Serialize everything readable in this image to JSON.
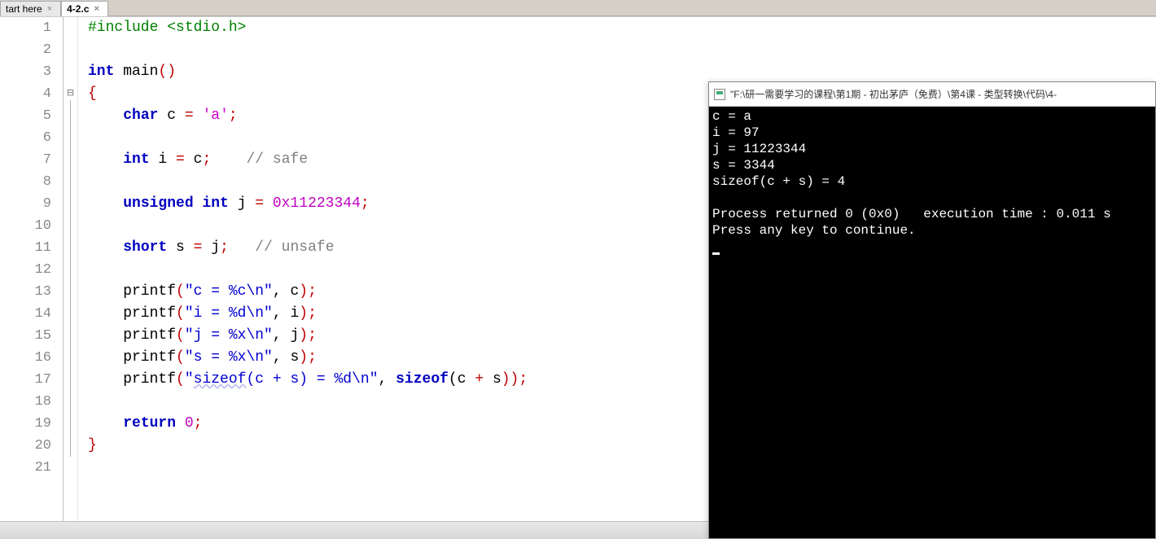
{
  "tabs": [
    {
      "label": "tart here",
      "active": false
    },
    {
      "label": "4-2.c",
      "active": true
    }
  ],
  "line_count": 21,
  "fold_marker_line": 4,
  "code_lines": [
    {
      "n": 1,
      "tokens": [
        {
          "t": "#include ",
          "c": "pp"
        },
        {
          "t": "<stdio.h>",
          "c": "pp"
        }
      ]
    },
    {
      "n": 2,
      "tokens": []
    },
    {
      "n": 3,
      "tokens": [
        {
          "t": "int",
          "c": "kw"
        },
        {
          "t": " main",
          "c": "id"
        },
        {
          "t": "()",
          "c": "op"
        }
      ]
    },
    {
      "n": 4,
      "tokens": [
        {
          "t": "{",
          "c": "op"
        }
      ]
    },
    {
      "n": 5,
      "tokens": [
        {
          "t": "    ",
          "c": "id"
        },
        {
          "t": "char",
          "c": "kw"
        },
        {
          "t": " c ",
          "c": "id"
        },
        {
          "t": "=",
          "c": "op"
        },
        {
          "t": " ",
          "c": "id"
        },
        {
          "t": "'a'",
          "c": "chr"
        },
        {
          "t": ";",
          "c": "op"
        }
      ]
    },
    {
      "n": 6,
      "tokens": []
    },
    {
      "n": 7,
      "tokens": [
        {
          "t": "    ",
          "c": "id"
        },
        {
          "t": "int",
          "c": "kw"
        },
        {
          "t": " i ",
          "c": "id"
        },
        {
          "t": "=",
          "c": "op"
        },
        {
          "t": " c",
          "c": "id"
        },
        {
          "t": ";",
          "c": "op"
        },
        {
          "t": "    ",
          "c": "id"
        },
        {
          "t": "// safe",
          "c": "cmt"
        }
      ]
    },
    {
      "n": 8,
      "tokens": []
    },
    {
      "n": 9,
      "tokens": [
        {
          "t": "    ",
          "c": "id"
        },
        {
          "t": "unsigned int",
          "c": "kw"
        },
        {
          "t": " j ",
          "c": "id"
        },
        {
          "t": "=",
          "c": "op"
        },
        {
          "t": " ",
          "c": "id"
        },
        {
          "t": "0x11223344",
          "c": "num"
        },
        {
          "t": ";",
          "c": "op"
        }
      ]
    },
    {
      "n": 10,
      "tokens": []
    },
    {
      "n": 11,
      "tokens": [
        {
          "t": "    ",
          "c": "id"
        },
        {
          "t": "short",
          "c": "kw"
        },
        {
          "t": " s ",
          "c": "id"
        },
        {
          "t": "=",
          "c": "op"
        },
        {
          "t": " j",
          "c": "id"
        },
        {
          "t": ";",
          "c": "op"
        },
        {
          "t": "   ",
          "c": "id"
        },
        {
          "t": "// unsafe",
          "c": "cmt"
        }
      ]
    },
    {
      "n": 12,
      "tokens": []
    },
    {
      "n": 13,
      "tokens": [
        {
          "t": "    printf",
          "c": "id"
        },
        {
          "t": "(",
          "c": "op"
        },
        {
          "t": "\"c = %c\\n\"",
          "c": "str"
        },
        {
          "t": ", c",
          "c": "id"
        },
        {
          "t": ");",
          "c": "op"
        }
      ]
    },
    {
      "n": 14,
      "tokens": [
        {
          "t": "    printf",
          "c": "id"
        },
        {
          "t": "(",
          "c": "op"
        },
        {
          "t": "\"i = %d\\n\"",
          "c": "str"
        },
        {
          "t": ", i",
          "c": "id"
        },
        {
          "t": ");",
          "c": "op"
        }
      ]
    },
    {
      "n": 15,
      "tokens": [
        {
          "t": "    printf",
          "c": "id"
        },
        {
          "t": "(",
          "c": "op"
        },
        {
          "t": "\"j = %x\\n\"",
          "c": "str"
        },
        {
          "t": ", j",
          "c": "id"
        },
        {
          "t": ");",
          "c": "op"
        }
      ]
    },
    {
      "n": 16,
      "tokens": [
        {
          "t": "    printf",
          "c": "id"
        },
        {
          "t": "(",
          "c": "op"
        },
        {
          "t": "\"s = %x\\n\"",
          "c": "str"
        },
        {
          "t": ", s",
          "c": "id"
        },
        {
          "t": ");",
          "c": "op"
        }
      ]
    },
    {
      "n": 17,
      "tokens": [
        {
          "t": "    printf",
          "c": "id"
        },
        {
          "t": "(",
          "c": "op"
        },
        {
          "t": "\"",
          "c": "str"
        },
        {
          "t": "sizeof",
          "c": "str under"
        },
        {
          "t": "(c + s) = %d\\n\"",
          "c": "str"
        },
        {
          "t": ", ",
          "c": "id"
        },
        {
          "t": "sizeof",
          "c": "kw"
        },
        {
          "t": "(c ",
          "c": "id"
        },
        {
          "t": "+",
          "c": "op"
        },
        {
          "t": " s",
          "c": "id"
        },
        {
          "t": "));",
          "c": "op"
        }
      ]
    },
    {
      "n": 18,
      "tokens": []
    },
    {
      "n": 19,
      "tokens": [
        {
          "t": "    ",
          "c": "id"
        },
        {
          "t": "return",
          "c": "kw"
        },
        {
          "t": " ",
          "c": "id"
        },
        {
          "t": "0",
          "c": "num"
        },
        {
          "t": ";",
          "c": "op"
        }
      ]
    },
    {
      "n": 20,
      "tokens": [
        {
          "t": "}",
          "c": "op"
        }
      ]
    },
    {
      "n": 21,
      "tokens": []
    }
  ],
  "console": {
    "title": "\"F:\\研一需要学习的课程\\第1期 - 初出茅庐（免费）\\第4课 - 类型转换\\代码\\4-",
    "lines": [
      "c = a",
      "i = 97",
      "j = 11223344",
      "s = 3344",
      "sizeof(c + s) = 4",
      "",
      "Process returned 0 (0x0)   execution time : 0.011 s",
      "Press any key to continue."
    ]
  }
}
